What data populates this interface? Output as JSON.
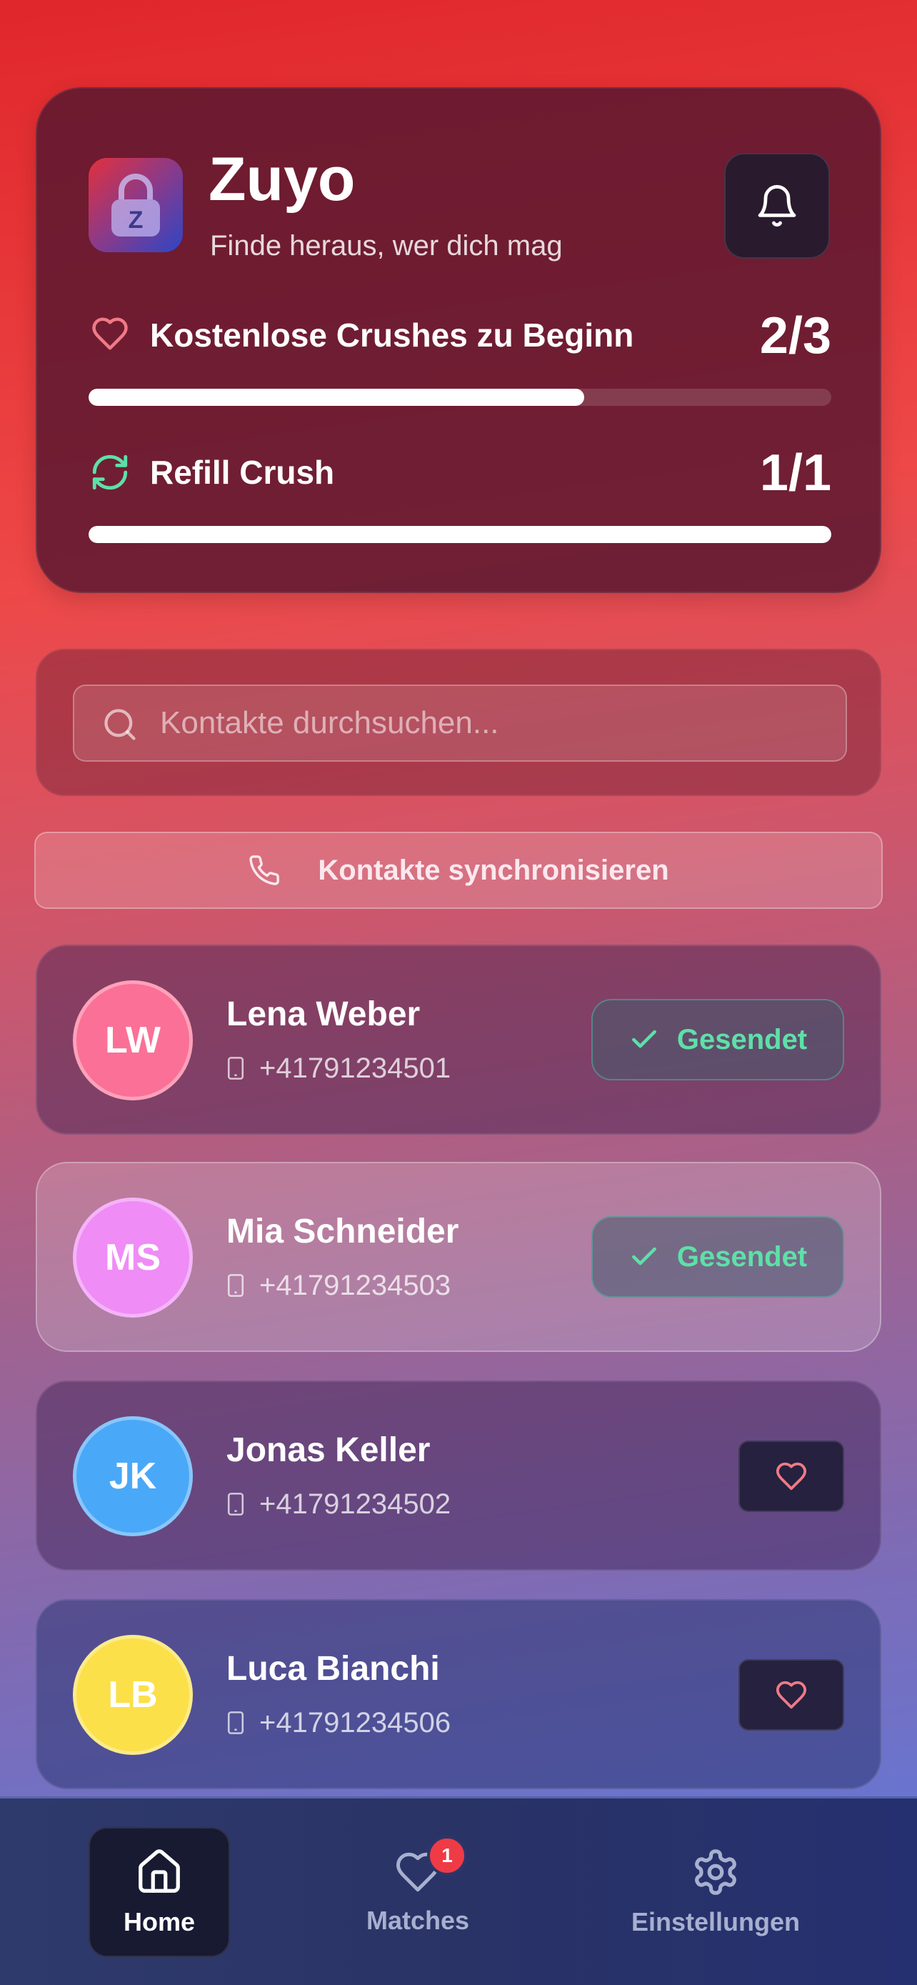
{
  "header": {
    "app_title": "Zuyo",
    "subtitle": "Finde heraus, wer dich mag",
    "logo_letter": "Z",
    "free_crushes": {
      "label": "Kostenlose Crushes zu Beginn",
      "value": "2/3",
      "progress": 0.667
    },
    "refill_crush": {
      "label": "Refill Crush",
      "value": "1/1",
      "progress": 1.0
    }
  },
  "search": {
    "placeholder": "Kontakte durchsuchen..."
  },
  "sync": {
    "label": "Kontakte synchronisieren"
  },
  "contacts": [
    {
      "initials": "LW",
      "name": "Lena Weber",
      "phone": "+41791234501",
      "status": "sent",
      "action_label": "Gesendet",
      "avatar_color": "#fb7096"
    },
    {
      "initials": "MS",
      "name": "Mia Schneider",
      "phone": "+41791234503",
      "status": "sent",
      "action_label": "Gesendet",
      "avatar_color": "#ef8cf6"
    },
    {
      "initials": "JK",
      "name": "Jonas Keller",
      "phone": "+41791234502",
      "status": "like",
      "action_label": "",
      "avatar_color": "#4aa8f8"
    },
    {
      "initials": "LB",
      "name": "Luca Bianchi",
      "phone": "+41791234506",
      "status": "like",
      "action_label": "",
      "avatar_color": "#fbe04a"
    }
  ],
  "nav": {
    "home": "Home",
    "matches": "Matches",
    "matches_badge": "1",
    "settings": "Einstellungen"
  },
  "colors": {
    "accent_green": "#5ee0a8",
    "heart_pink": "#f07a86",
    "badge_red": "#ef3b46"
  }
}
